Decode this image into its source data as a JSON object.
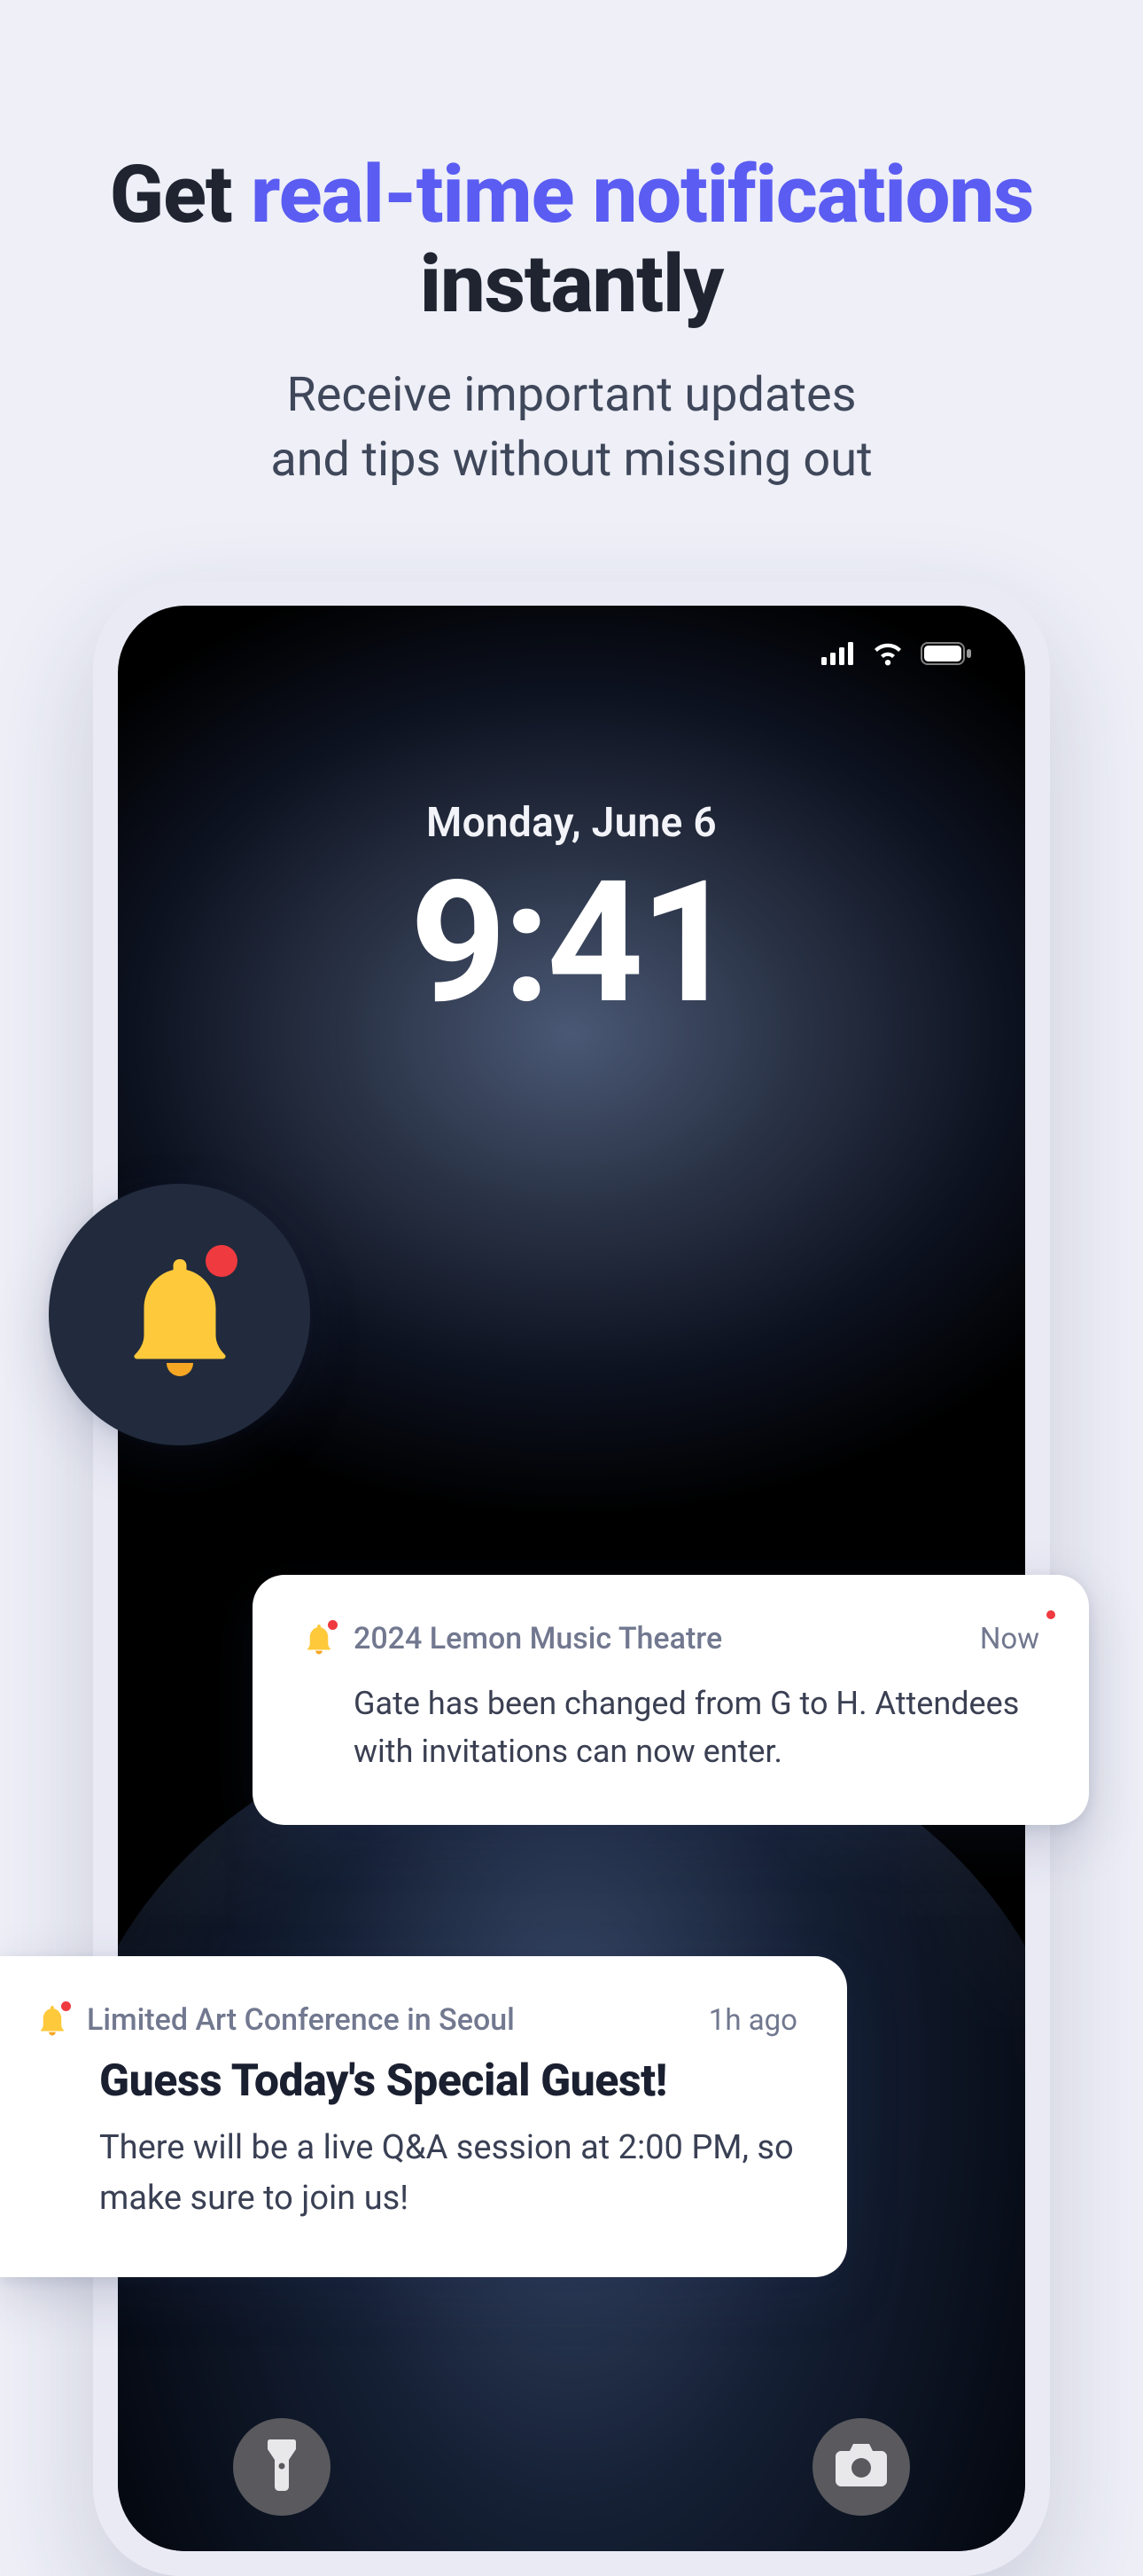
{
  "headline": {
    "pre": "Get ",
    "accent": "real-time notifications",
    "post": " instantly"
  },
  "subtitle_line1": "Receive important updates",
  "subtitle_line2": "and tips without missing out",
  "lockscreen": {
    "date": "Monday, June 6",
    "time": "9:41"
  },
  "notif_small": {
    "source": "2024 Lemon Music Theatre",
    "ago": "Now",
    "body": "Gate has been changed from G to H. Attendees with invitations can now enter."
  },
  "notif_big": {
    "source": "Limited Art Conference in Seoul",
    "ago": "1h ago",
    "title": "Guess Today's Special Guest!",
    "body": "There will be a live Q&A session at 2:00 PM, so make sure to join us!"
  }
}
